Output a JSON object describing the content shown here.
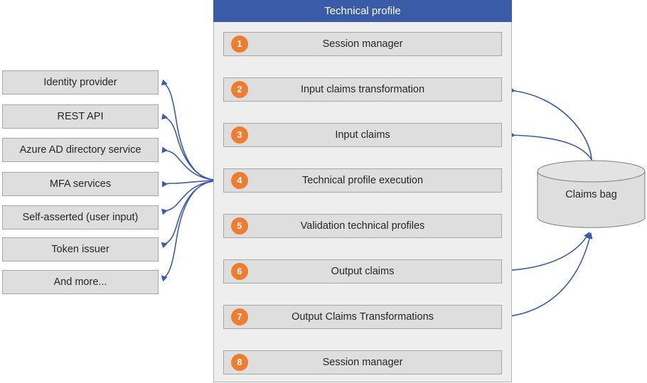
{
  "panel": {
    "title": "Technical profile",
    "header_color": "#3a5ba8",
    "steps": [
      {
        "num": "1",
        "label": "Session manager"
      },
      {
        "num": "2",
        "label": "Input claims transformation"
      },
      {
        "num": "3",
        "label": "Input claims"
      },
      {
        "num": "4",
        "label": "Technical profile execution"
      },
      {
        "num": "5",
        "label": "Validation technical profiles"
      },
      {
        "num": "6",
        "label": "Output claims"
      },
      {
        "num": "7",
        "label": "Output Claims Transformations"
      },
      {
        "num": "8",
        "label": "Session manager"
      }
    ]
  },
  "sources": {
    "items": [
      {
        "label": "Identity provider"
      },
      {
        "label": "REST API"
      },
      {
        "label": "Azure AD directory service"
      },
      {
        "label": "MFA services"
      },
      {
        "label": "Self-asserted (user input)"
      },
      {
        "label": "Token issuer"
      },
      {
        "label": "And more..."
      }
    ]
  },
  "datastore": {
    "label": "Claims bag"
  },
  "colors": {
    "accent_orange": "#ed7d31",
    "header_blue": "#3a5ba8",
    "arrow_blue": "#3b5ba8",
    "box_fill": "#dedede",
    "box_border": "#a6a6a6",
    "panel_fill": "#eeeeee"
  }
}
